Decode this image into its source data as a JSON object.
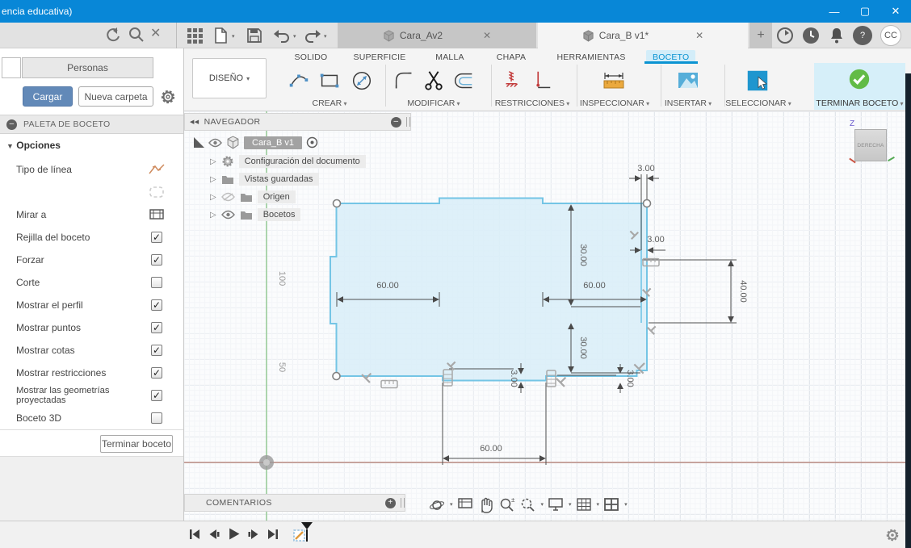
{
  "titlebar": {
    "title": "encia educativa)"
  },
  "appbar": {
    "doc_tabs": [
      {
        "label": "Cara_Av2"
      },
      {
        "label": "Cara_B v1*"
      }
    ],
    "avatar": "CC"
  },
  "ribbon": {
    "design_button": "DISEÑO",
    "tabs": [
      {
        "label": "SOLIDO"
      },
      {
        "label": "SUPERFICIE"
      },
      {
        "label": "MALLA"
      },
      {
        "label": "CHAPA"
      },
      {
        "label": "HERRAMIENTAS"
      },
      {
        "label": "BOCETO",
        "active": true
      }
    ],
    "groups": [
      {
        "label": "CREAR"
      },
      {
        "label": "MODIFICAR"
      },
      {
        "label": "RESTRICCIONES"
      },
      {
        "label": "INSPECCIONAR"
      },
      {
        "label": "INSERTAR"
      },
      {
        "label": "SELECCIONAR"
      },
      {
        "label": "TERMINAR BOCETO"
      }
    ],
    "accent_color": "#0a93d2"
  },
  "left_panel": {
    "personas_tab": "Personas",
    "upload_button": "Cargar",
    "new_folder_button": "Nueva carpeta",
    "palette_title": "PALETA DE BOCETO",
    "options_header": "Opciones",
    "options": [
      {
        "label": "Tipo de línea",
        "control": "icon"
      },
      {
        "label": "",
        "control": "icon"
      },
      {
        "label": "Mirar a",
        "control": "icon"
      },
      {
        "label": "Rejilla del boceto",
        "checked": true
      },
      {
        "label": "Forzar",
        "checked": true
      },
      {
        "label": "Corte",
        "checked": false
      },
      {
        "label": "Mostrar el perfil",
        "checked": true
      },
      {
        "label": "Mostrar puntos",
        "checked": true
      },
      {
        "label": "Mostrar cotas",
        "checked": true
      },
      {
        "label": "Mostrar restricciones",
        "checked": true
      },
      {
        "label": "Mostrar las geometrías proyectadas",
        "checked": true
      },
      {
        "label": "Boceto 3D",
        "checked": false
      }
    ],
    "finish_button": "Terminar boceto"
  },
  "navigator": {
    "title": "NAVEGADOR",
    "root": "Cara_B v1",
    "items": [
      {
        "label": "Configuración del documento"
      },
      {
        "label": "Vistas guardadas"
      },
      {
        "label": "Origen"
      },
      {
        "label": "Bocetos"
      }
    ]
  },
  "canvas": {
    "viewcube_face": "DERECHA",
    "axis_z": "Z",
    "grid_labels": {
      "v100": "100",
      "v50": "50"
    },
    "dims": {
      "top_wall": "3.00",
      "upper_depth": "30.00",
      "mid_wall_right": "3.00",
      "width_left": "60.00",
      "width_right": "60.00",
      "right_opening": "40.00",
      "lower_depth": "30.00",
      "bottom_wall_mid": "3.00",
      "bottom_wall_right": "3.00",
      "width_bottom": "60.00"
    },
    "sketch_fill": "#d8edf8",
    "sketch_stroke": "#74c5e5",
    "comments_bar": "COMENTARIOS"
  }
}
